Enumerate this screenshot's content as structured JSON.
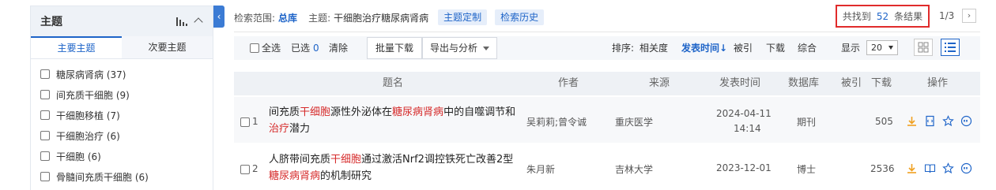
{
  "sidebar": {
    "title": "主题",
    "collapse_glyph": "‹",
    "tabs": [
      "主要主题",
      "次要主题"
    ],
    "facets": [
      {
        "label": "糖尿病肾病 (37)"
      },
      {
        "label": "间充质干细胞 (9)"
      },
      {
        "label": "干细胞移植 (7)"
      },
      {
        "label": "干细胞治疗 (6)"
      },
      {
        "label": "干细胞 (6)"
      },
      {
        "label": "骨髓间充质干细胞 (6)"
      }
    ]
  },
  "search": {
    "scope_label": "检索范围:",
    "scope_value": "总库",
    "topic_label": "主题:",
    "topic_value": "干细胞治疗糖尿病肾病",
    "custom_topic": "主题定制",
    "history": "检索历史",
    "found_prefix": "共找到",
    "found_count": "52",
    "found_suffix": "条结果",
    "page": "1/3",
    "next": "›"
  },
  "toolbar": {
    "select_all": "全选",
    "selected_label": "已选",
    "selected_count": "0",
    "clear": "清除",
    "batch_download": "批量下载",
    "export": "导出与分析",
    "sort_label": "排序:",
    "sort_options": [
      "相关度",
      "发表时间↓",
      "被引",
      "下载",
      "综合"
    ],
    "show_label": "显示",
    "page_size": "20"
  },
  "table": {
    "headers": [
      "题名",
      "作者",
      "来源",
      "发表时间",
      "数据库",
      "被引",
      "下载",
      "操作"
    ],
    "rows": [
      {
        "num": "1",
        "title_parts": [
          "间充质",
          "干细胞",
          "源性外泌体在",
          "糖尿病肾病",
          "中的自噬调节和",
          "治疗",
          "潜力"
        ],
        "author": "吴莉莉;曾令诚",
        "source": "重庆医学",
        "date": "2024-04-11",
        "time": "14:14",
        "db": "期刊",
        "cited": "",
        "downloads": "505"
      },
      {
        "num": "2",
        "title_parts": [
          "人脐带间充质",
          "干细胞",
          "通过激活Nrf2调控铁死亡改善2型",
          "糖尿病肾病",
          "的机制研究"
        ],
        "author": "朱月新",
        "source": "吉林大学",
        "date": "2023-12-01",
        "time": "",
        "db": "博士",
        "cited": "",
        "downloads": "2536"
      }
    ]
  },
  "colors": {
    "accent": "#1e64c8",
    "highlight": "#d62b2b",
    "download_icon": "#f0a020",
    "result_border": "#e02b2b"
  },
  "icons": [
    "bar-chart-icon",
    "chevron-up-icon",
    "grid-view-icon",
    "list-view-icon",
    "download-icon",
    "read-icon",
    "favorite-icon",
    "quote-icon"
  ]
}
